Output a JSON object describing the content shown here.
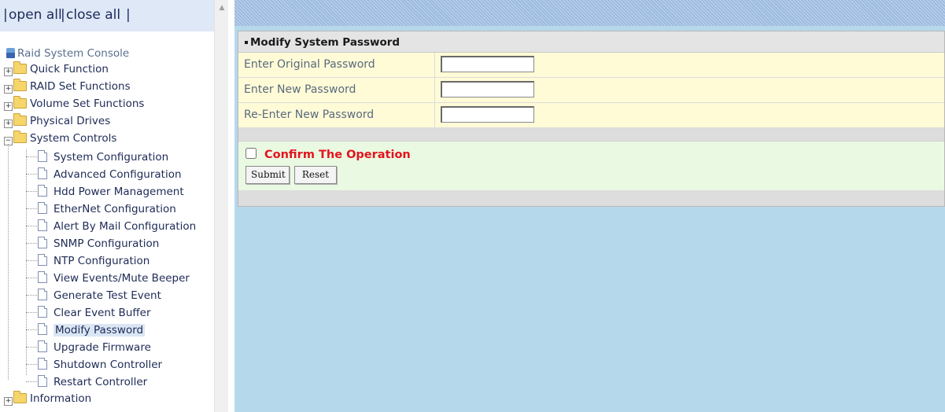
{
  "tree": {
    "open_all": "open all",
    "close_all": "close all",
    "sep": "|",
    "root": "Raid System Console",
    "nodes": [
      {
        "label": "Quick Function",
        "expander": "+"
      },
      {
        "label": "RAID Set Functions",
        "expander": "+"
      },
      {
        "label": "Volume Set Functions",
        "expander": "+"
      },
      {
        "label": "Physical Drives",
        "expander": "+"
      },
      {
        "label": "System Controls",
        "expander": "−"
      }
    ],
    "leaves": [
      "System Configuration",
      "Advanced Configuration",
      "Hdd Power Management",
      "EtherNet Configuration",
      "Alert By Mail Configuration",
      "SNMP Configuration",
      "NTP Configuration",
      "View Events/Mute Beeper",
      "Generate Test Event",
      "Clear Event Buffer",
      "Modify Password",
      "Upgrade Firmware",
      "Shutdown Controller",
      "Restart Controller"
    ],
    "selected_leaf": "Modify Password",
    "last_node": {
      "label": "Information",
      "expander": "+"
    }
  },
  "form": {
    "title": "Modify System Password",
    "fields": [
      {
        "label": "Enter Original Password",
        "value": ""
      },
      {
        "label": "Enter New Password",
        "value": ""
      },
      {
        "label": "Re-Enter New Password",
        "value": ""
      }
    ],
    "confirm_label": "Confirm The Operation",
    "confirm_checked": false,
    "submit_label": "Submit",
    "reset_label": "Reset"
  },
  "icons": {
    "root": "console-icon",
    "folder": "folder-icon",
    "page": "page-icon",
    "scroll_up": "scroll-up-icon"
  },
  "colors": {
    "content_background": "#b6d8eb",
    "form_row": "#fffbd7",
    "confirm_area": "#eaf9e2",
    "confirm_text": "#e3141e",
    "open_close_bar": "#dfe8f6"
  }
}
